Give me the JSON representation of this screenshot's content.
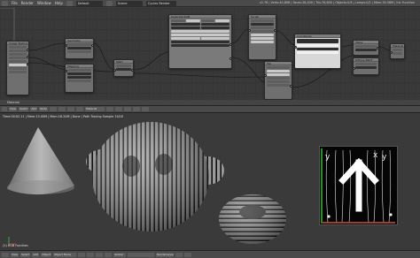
{
  "topbar": {
    "menus": [
      "File",
      "Render",
      "Window",
      "Help"
    ],
    "layout_label": "Default",
    "scene_label": "Scene",
    "engine_label": "Cycles Render",
    "stats": "v2.76 | Verts:40,898 | Faces:38,400 | Tris:76,800 | Objects:0/4 | Lamps:0/2 | Mem:30.56M | Ink Function"
  },
  "node_editor": {
    "nodes": [
      {
        "id": "n-a",
        "title": "Image Texture"
      },
      {
        "id": "n-b",
        "title": "Geometry"
      },
      {
        "id": "n-c",
        "title": "Mapping"
      },
      {
        "id": "n-d",
        "title": "Math"
      },
      {
        "id": "n-e",
        "title": "Separate RGB"
      },
      {
        "id": "n-f",
        "title": "Script"
      },
      {
        "id": "n-g",
        "title": "Mix"
      },
      {
        "id": "n-h",
        "title": "ColorRamp"
      },
      {
        "id": "n-i",
        "title": "Value"
      },
      {
        "id": "n-j",
        "title": "Diffuse BSDF"
      },
      {
        "id": "n-k",
        "title": "Material Output"
      }
    ],
    "material_label": "Material"
  },
  "view_header": {
    "buttons": [
      "View",
      "Select",
      "Add",
      "Node"
    ],
    "material_field": "Material"
  },
  "viewport": {
    "info_line": "Time:00:02.11 | Mem:13.00M | Mem:18.20M | Done | Path Tracing Sample 10/10",
    "object_label": "(1) RGB Function",
    "texture_glyphs": [
      "y",
      "x",
      "y"
    ]
  },
  "footer": {
    "buttons": [
      "View",
      "Select",
      "Add",
      "Object"
    ],
    "mode_label": "Object Mode",
    "shading_label": "Global",
    "render_layer": "RenderLayer"
  },
  "colors": {
    "socket_yellow": "#c8c83a",
    "socket_blue": "#6363c7",
    "socket_green": "#63c763",
    "axis_red": "#d03030",
    "axis_green": "#30d030"
  }
}
